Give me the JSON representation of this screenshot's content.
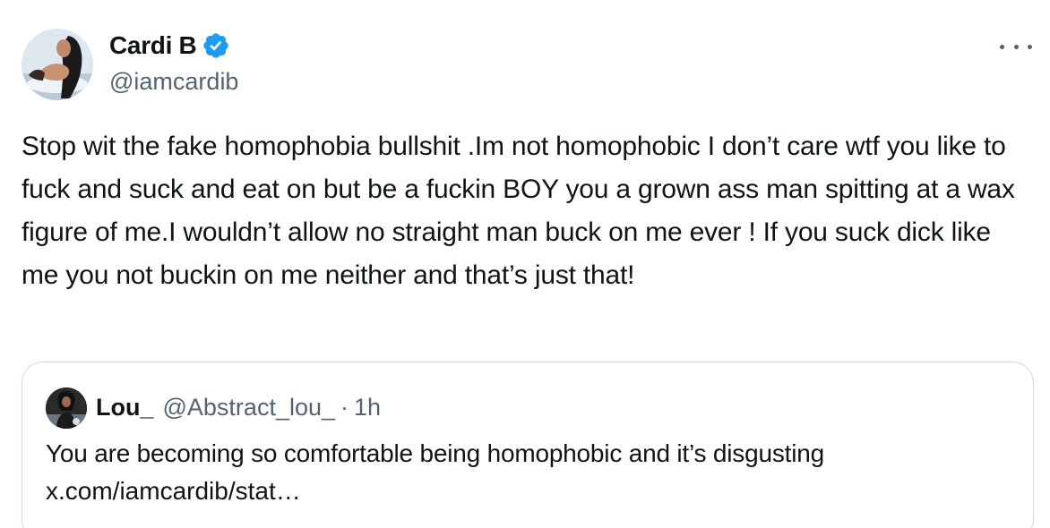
{
  "author": {
    "display_name": "Cardi B",
    "handle": "@iamcardib",
    "verified": true,
    "avatar_icon": "profile-photo"
  },
  "menu": {
    "icon": "more-horizontal-icon"
  },
  "tweet": {
    "text": "Stop wit the fake homophobia bullshit .Im not homophobic I don’t care wtf you like to fuck and suck and eat on but be a fuckin BOY you a grown ass man spitting at a wax figure of me.I wouldn’t allow no straight man buck on me ever ! If you suck dick like me you not buckin on me neither and that’s just that!"
  },
  "quoted": {
    "display_name": "Lou_",
    "handle": "@Abstract_lou_",
    "separator": "·",
    "time": "1h",
    "text": "You are becoming so comfortable being homophobic and it’s disgusting",
    "link": "x.com/iamcardib/stat…"
  },
  "colors": {
    "verified_blue": "#1d9bf0",
    "secondary_text": "#536471",
    "border": "#cfd9de",
    "primary_text": "#0f1419"
  }
}
